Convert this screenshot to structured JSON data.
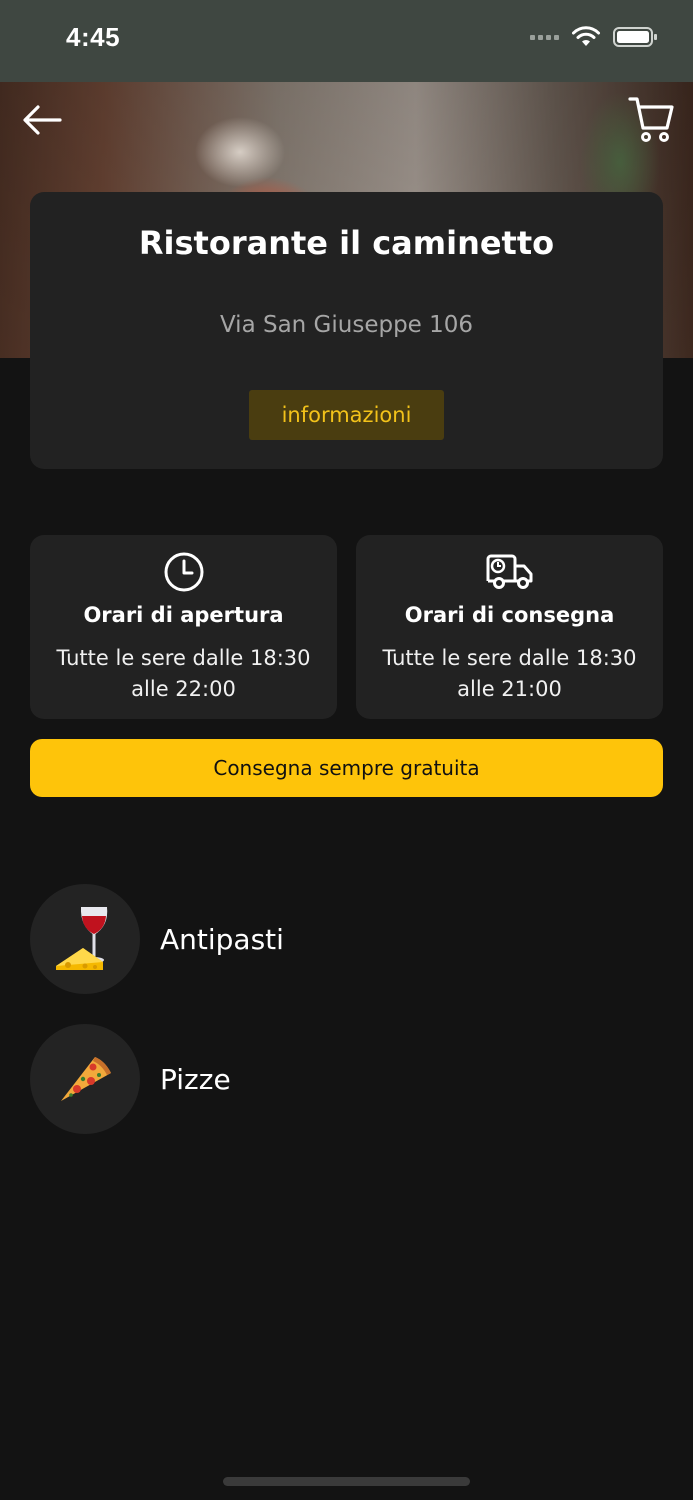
{
  "status_bar": {
    "time": "4:45",
    "icons": [
      "signal-icon",
      "wifi-icon",
      "battery-icon"
    ]
  },
  "header": {
    "back_icon": "arrow-left-icon",
    "cart_icon": "shopping-cart-icon"
  },
  "restaurant": {
    "name": "Ristorante il caminetto",
    "address": "Via San Giuseppe 106",
    "info_button_label": "informazioni"
  },
  "hours": [
    {
      "icon": "clock-icon",
      "title": "Orari di apertura",
      "line1": "Tutte le sere dalle 18:30",
      "line2": "alle 22:00"
    },
    {
      "icon": "delivery-truck-icon",
      "title": "Orari di consegna",
      "line1": "Tutte le sere dalle 18:30",
      "line2": "alle 21:00"
    }
  ],
  "delivery_banner": "Consegna sempre gratuita",
  "categories": [
    {
      "icon": "wine-cheese-icon",
      "label": "Antipasti"
    },
    {
      "icon": "pizza-slice-icon",
      "label": "Pizze"
    }
  ],
  "colors": {
    "background": "#131313",
    "card": "#222222",
    "accent": "#fec40a",
    "status_bar": "#3f4741"
  }
}
